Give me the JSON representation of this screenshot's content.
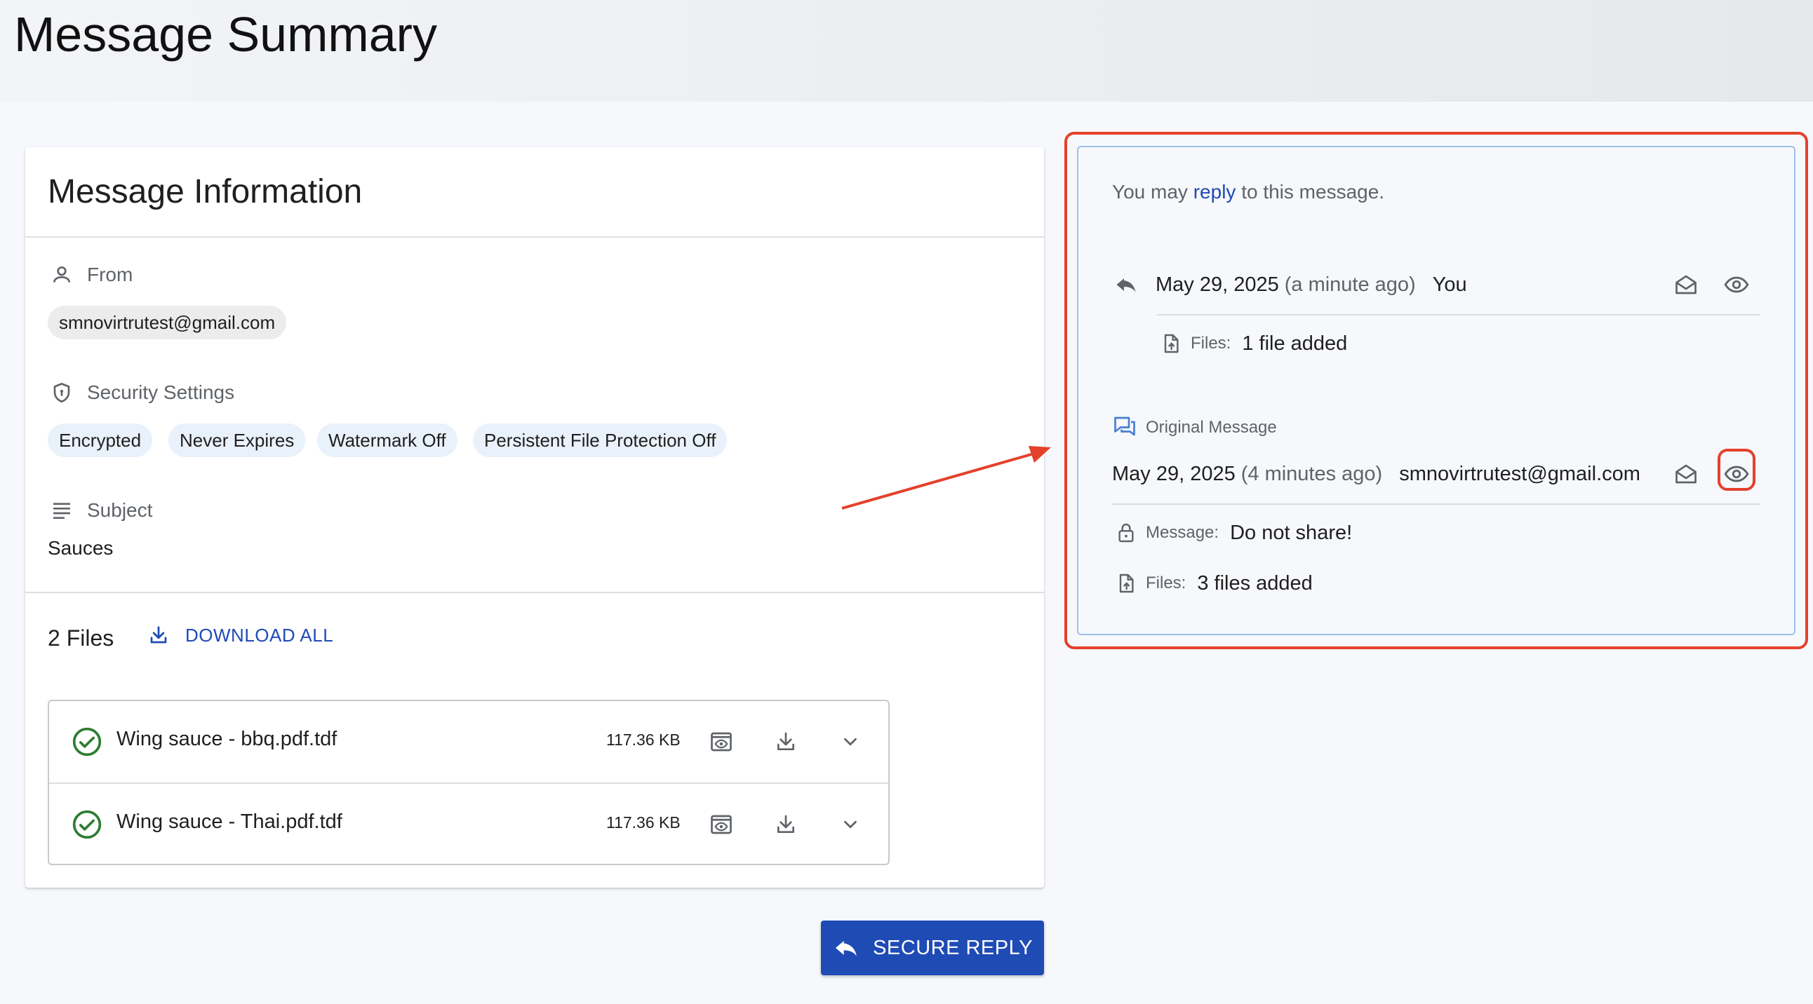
{
  "page": {
    "title": "Message Summary"
  },
  "info": {
    "title": "Message Information",
    "from_label": "From",
    "from_email": "smnovirtrutest@gmail.com",
    "security_label": "Security Settings",
    "security_chips": [
      "Encrypted",
      "Never Expires",
      "Watermark Off",
      "Persistent File Protection Off"
    ],
    "subject_label": "Subject",
    "subject_value": "Sauces"
  },
  "files": {
    "count_label": "2 Files",
    "download_all": "DOWNLOAD ALL",
    "items": [
      {
        "name": "Wing sauce - bbq.pdf.tdf",
        "size": "117.36 KB",
        "status": "check-circle-icon"
      },
      {
        "name": "Wing sauce - Thai.pdf.tdf",
        "size": "117.36 KB",
        "status": "check-circle-icon"
      }
    ]
  },
  "secure_reply": "SECURE REPLY",
  "history": {
    "note_prefix": "You may",
    "note_link": "reply",
    "note_suffix": "to this message.",
    "reply_event": {
      "date": "May 29, 2025",
      "relative": "(a minute ago)",
      "who": "You",
      "files_label": "Files:",
      "files_value": "1 file added"
    },
    "original": {
      "label": "Original Message",
      "date": "May 29, 2025",
      "relative": "(4 minutes ago)",
      "who": "smnovirtrutest@gmail.com",
      "message_label": "Message:",
      "message_value": "Do not share!",
      "files_label": "Files:",
      "files_value": "3 files added"
    }
  },
  "colors": {
    "accent": "#1f4bb5",
    "annotation": "#e4412b",
    "success": "#2e7d32",
    "panel_border": "#9fc0e8"
  }
}
